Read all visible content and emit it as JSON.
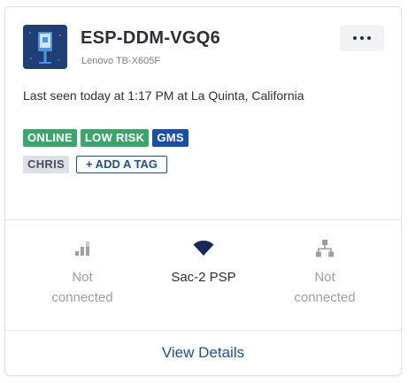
{
  "device": {
    "name": "ESP-DDM-VGQ6",
    "model": "Lenovo TB-X605F",
    "icon": "kiosk-icon",
    "last_seen": "Last seen today at 1:17 PM at La Quinta, California"
  },
  "menu": {
    "icon": "more-horizontal-icon"
  },
  "tags": {
    "status": [
      {
        "label": "ONLINE",
        "color": "#3aa66b"
      },
      {
        "label": "LOW RISK",
        "color": "#3aa66b"
      },
      {
        "label": "GMS",
        "color": "#1a4fa3"
      }
    ],
    "user_tags": [
      {
        "label": "CHRIS"
      }
    ],
    "add_tag_label": "+ ADD A TAG"
  },
  "connectivity": [
    {
      "icon": "cellular-signal-icon",
      "label_line1": "Not",
      "label_line2": "connected"
    },
    {
      "icon": "wifi-icon",
      "label_line1": "Sac-2 PSP"
    },
    {
      "icon": "network-icon",
      "label_line1": "Not",
      "label_line2": "connected"
    }
  ],
  "footer": {
    "view_details_label": "View Details"
  },
  "colors": {
    "accent": "#1a4fa3",
    "success": "#3aa66b",
    "muted": "#9aa0a8"
  }
}
